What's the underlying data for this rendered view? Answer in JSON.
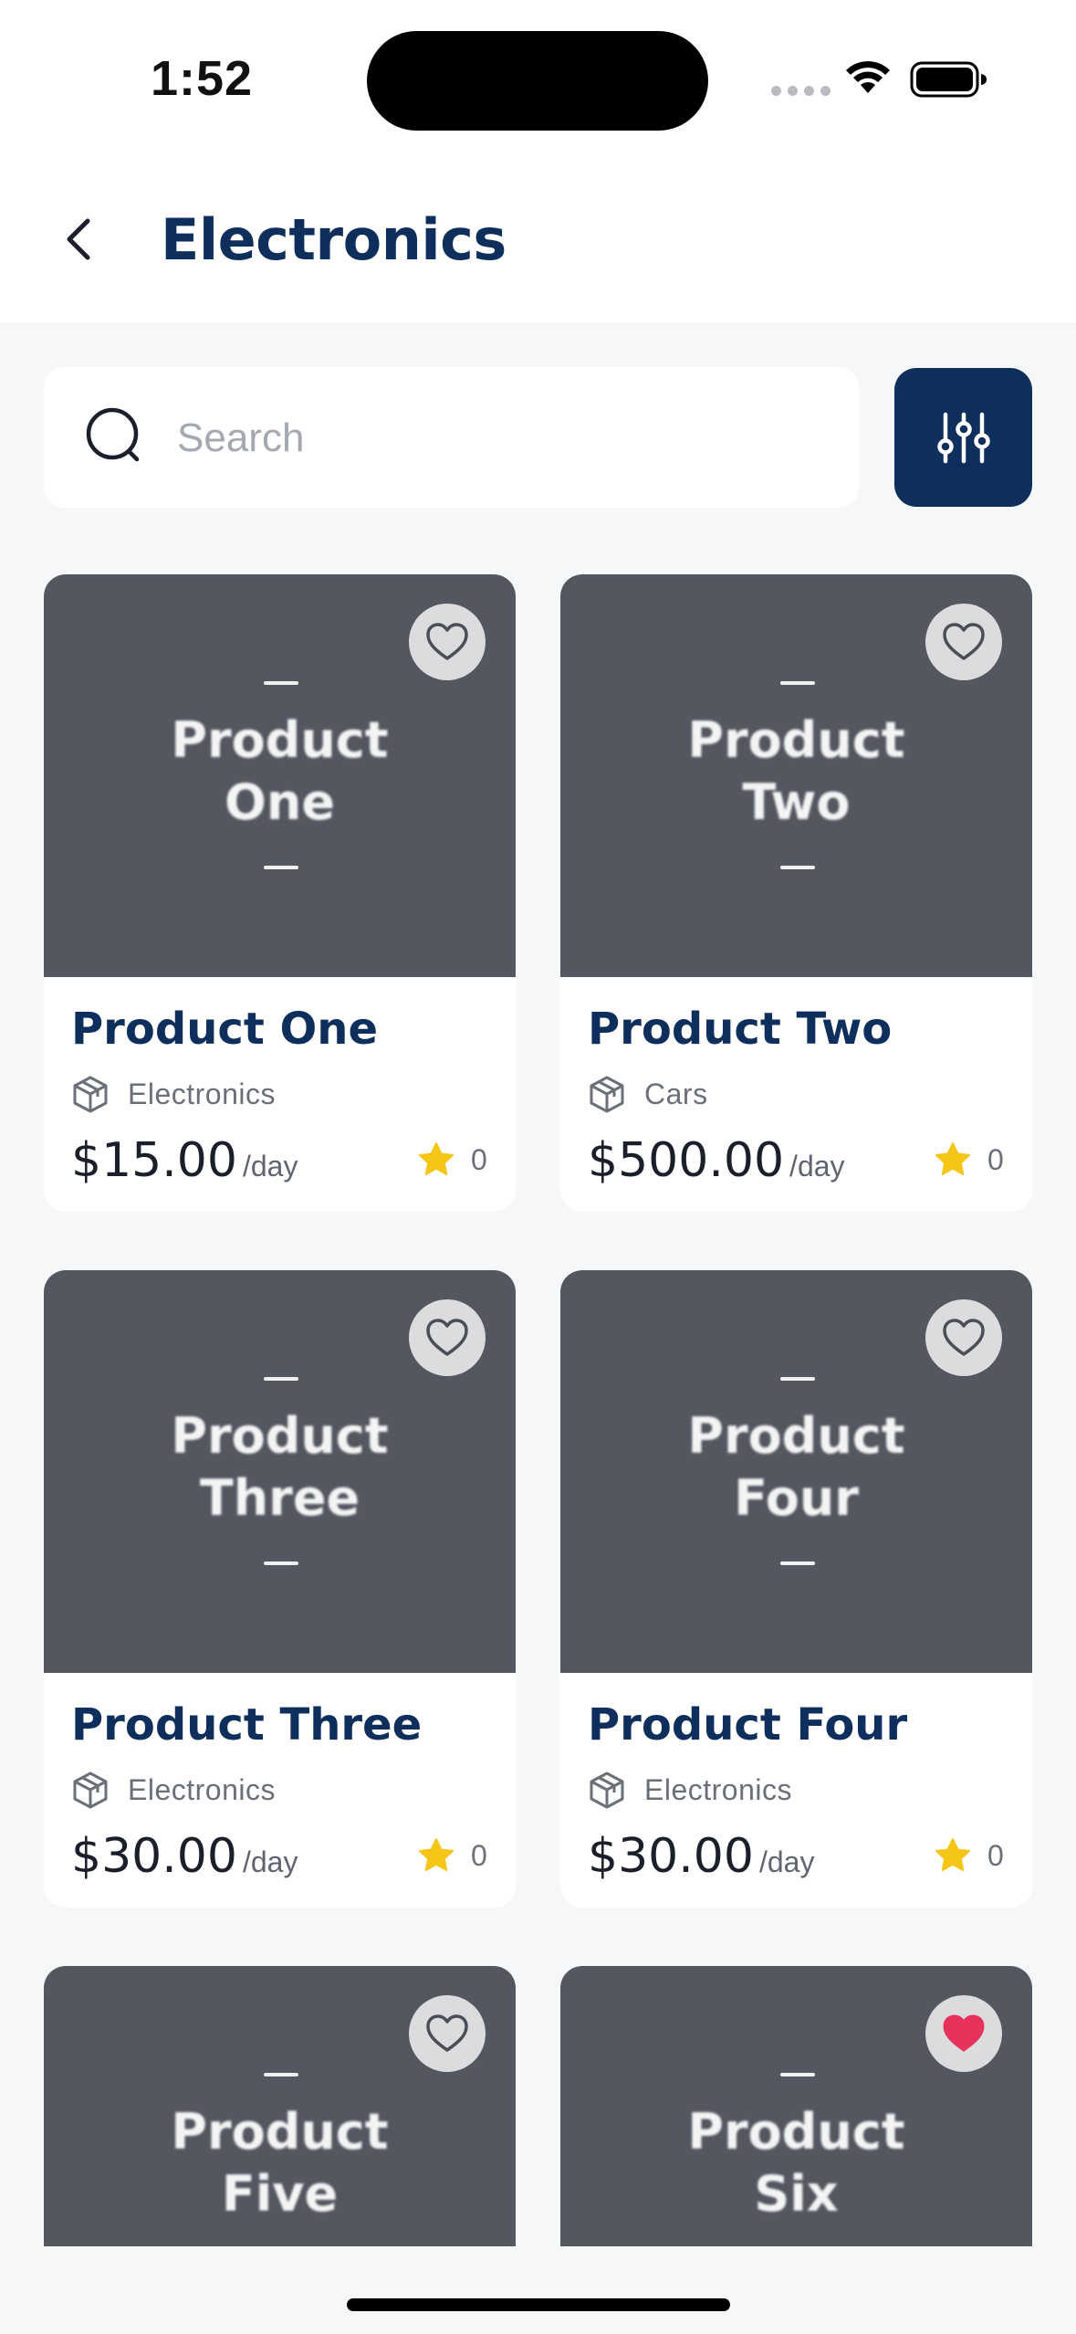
{
  "status_bar": {
    "time": "1:52"
  },
  "header": {
    "title": "Electronics"
  },
  "search": {
    "placeholder": "Search"
  },
  "per_day_label": "/day",
  "products": [
    {
      "image_text_1": "Product",
      "image_text_2": "One",
      "name": "Product One",
      "category": "Electronics",
      "price": "$15.00",
      "rating": "0",
      "favorite": false
    },
    {
      "image_text_1": "Product",
      "image_text_2": "Two",
      "name": "Product Two",
      "category": "Cars",
      "price": "$500.00",
      "rating": "0",
      "favorite": false
    },
    {
      "image_text_1": "Product",
      "image_text_2": "Three",
      "name": "Product Three",
      "category": "Electronics",
      "price": "$30.00",
      "rating": "0",
      "favorite": false
    },
    {
      "image_text_1": "Product",
      "image_text_2": "Four",
      "name": "Product Four",
      "category": "Electronics",
      "price": "$30.00",
      "rating": "0",
      "favorite": false
    },
    {
      "image_text_1": "Product",
      "image_text_2": "Five",
      "favorite": false
    },
    {
      "image_text_1": "Product",
      "image_text_2": "Six",
      "favorite": true
    }
  ],
  "colors": {
    "brand": "#0E2E5C",
    "card_image": "#535760",
    "star": "#F5C518",
    "favorite_active": "#E8325C",
    "background": "#F6F7F9"
  },
  "icons": [
    "back-chevron-icon",
    "search-icon",
    "filter-sliders-icon",
    "heart-icon",
    "package-icon",
    "star-icon",
    "wifi-icon",
    "battery-icon"
  ]
}
